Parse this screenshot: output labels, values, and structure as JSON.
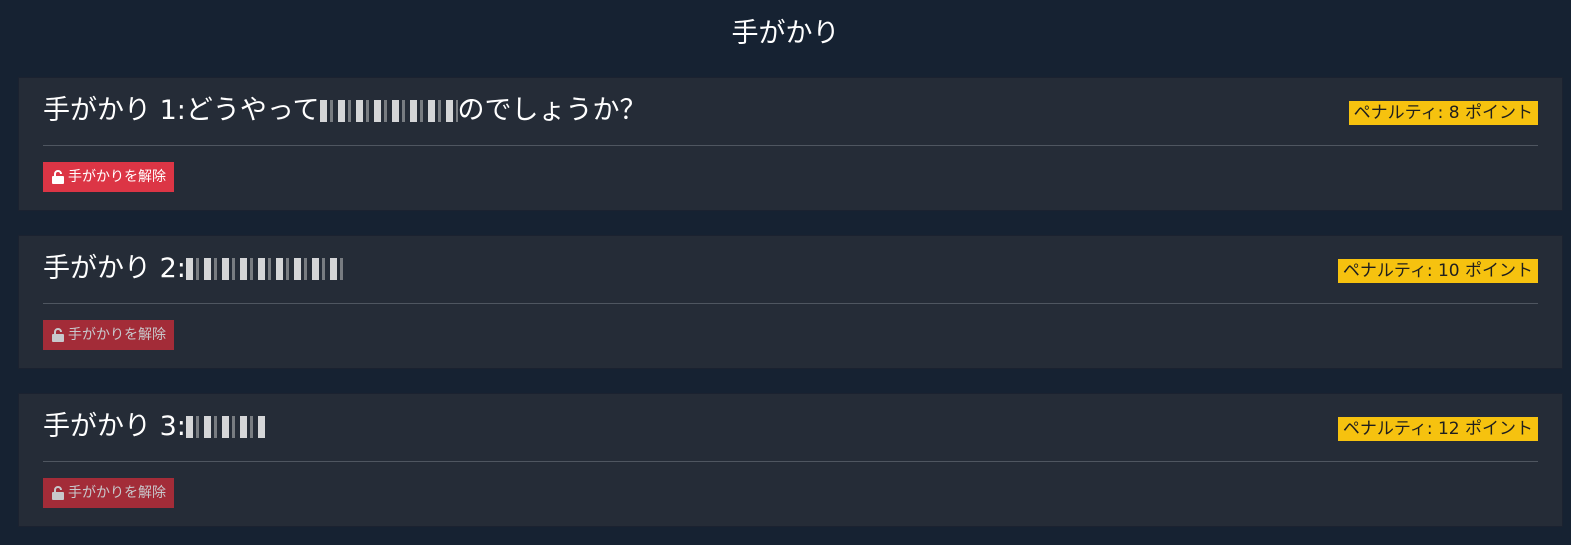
{
  "page": {
    "title": "手がかり"
  },
  "hints": [
    {
      "label": "手がかり 1:どうやって",
      "label_suffix": "のでしょうか？",
      "penalty": "ペナルティ: 8 ポイント",
      "button_label": "手がかりを解除",
      "enabled": true
    },
    {
      "label": "手がかり 2:",
      "label_suffix": "",
      "penalty": "ペナルティ: 10 ポイント",
      "button_label": "手がかりを解除",
      "enabled": false
    },
    {
      "label": "手がかり 3:",
      "label_suffix": "",
      "penalty": "ペナルティ: 12 ポイント",
      "button_label": "手がかりを解除",
      "enabled": false
    }
  ],
  "icons": {
    "unlock": "unlock-icon"
  },
  "colors": {
    "background": "#162232",
    "card": "#252c37",
    "badge": "#f6c20f",
    "button": "#dc3545",
    "button_disabled": "#a32c38"
  }
}
